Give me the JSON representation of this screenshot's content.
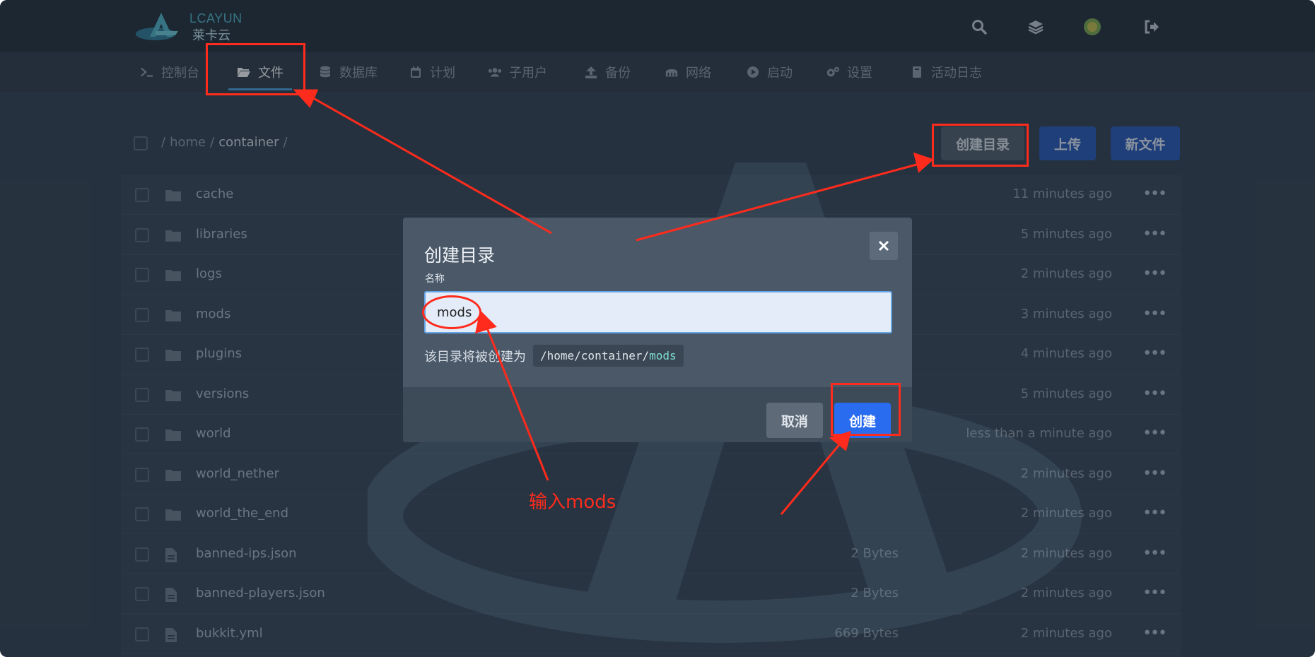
{
  "header": {
    "logo_text": "LCAYUN",
    "logo_subtext": "莱卡云",
    "icons": [
      "search-icon",
      "layers-icon",
      "avatar",
      "logout-icon"
    ]
  },
  "nav": {
    "items": [
      {
        "label": "控制台",
        "icon": "terminal-icon"
      },
      {
        "label": "文件",
        "icon": "folder-open-icon",
        "active": true
      },
      {
        "label": "数据库",
        "icon": "database-icon"
      },
      {
        "label": "计划",
        "icon": "calendar-icon"
      },
      {
        "label": "子用户",
        "icon": "users-icon"
      },
      {
        "label": "备份",
        "icon": "upload-icon"
      },
      {
        "label": "网络",
        "icon": "network-icon"
      },
      {
        "label": "启动",
        "icon": "play-icon"
      },
      {
        "label": "设置",
        "icon": "gears-icon"
      },
      {
        "label": "活动日志",
        "icon": "book-icon"
      }
    ]
  },
  "breadcrumb": {
    "sep": "/",
    "parts": [
      "home",
      "container"
    ]
  },
  "toolbar": {
    "create_dir": "创建目录",
    "upload": "上传",
    "new_file": "新文件"
  },
  "files": [
    {
      "name": "cache",
      "type": "folder",
      "size": "",
      "time": "11 minutes ago"
    },
    {
      "name": "libraries",
      "type": "folder",
      "size": "",
      "time": "5 minutes ago"
    },
    {
      "name": "logs",
      "type": "folder",
      "size": "",
      "time": "2 minutes ago"
    },
    {
      "name": "mods",
      "type": "folder",
      "size": "",
      "time": "3 minutes ago"
    },
    {
      "name": "plugins",
      "type": "folder",
      "size": "",
      "time": "4 minutes ago"
    },
    {
      "name": "versions",
      "type": "folder",
      "size": "",
      "time": "5 minutes ago"
    },
    {
      "name": "world",
      "type": "folder",
      "size": "",
      "time": "less than a minute ago"
    },
    {
      "name": "world_nether",
      "type": "folder",
      "size": "",
      "time": "2 minutes ago"
    },
    {
      "name": "world_the_end",
      "type": "folder",
      "size": "",
      "time": "2 minutes ago"
    },
    {
      "name": "banned-ips.json",
      "type": "file",
      "size": "2 Bytes",
      "time": "2 minutes ago"
    },
    {
      "name": "banned-players.json",
      "type": "file",
      "size": "2 Bytes",
      "time": "2 minutes ago"
    },
    {
      "name": "bukkit.yml",
      "type": "file",
      "size": "669 Bytes",
      "time": "2 minutes ago"
    }
  ],
  "row_menu": "•••",
  "modal": {
    "title": "创建目录",
    "field_label": "名称",
    "input_value": "mods",
    "hint_prefix": "该目录将被创建为",
    "path_prefix": "/home/container/",
    "path_name": "mods",
    "cancel": "取消",
    "create": "创建",
    "close_icon": "close-icon"
  },
  "annotation": {
    "text": "输入mods",
    "color": "#ff2b1c"
  },
  "colors": {
    "bg": "#2f3d4c",
    "header": "#1f2a36",
    "accent_blue": "#2456b8",
    "create_blue": "#2a6cf0",
    "active_underline": "#4aa3df"
  }
}
